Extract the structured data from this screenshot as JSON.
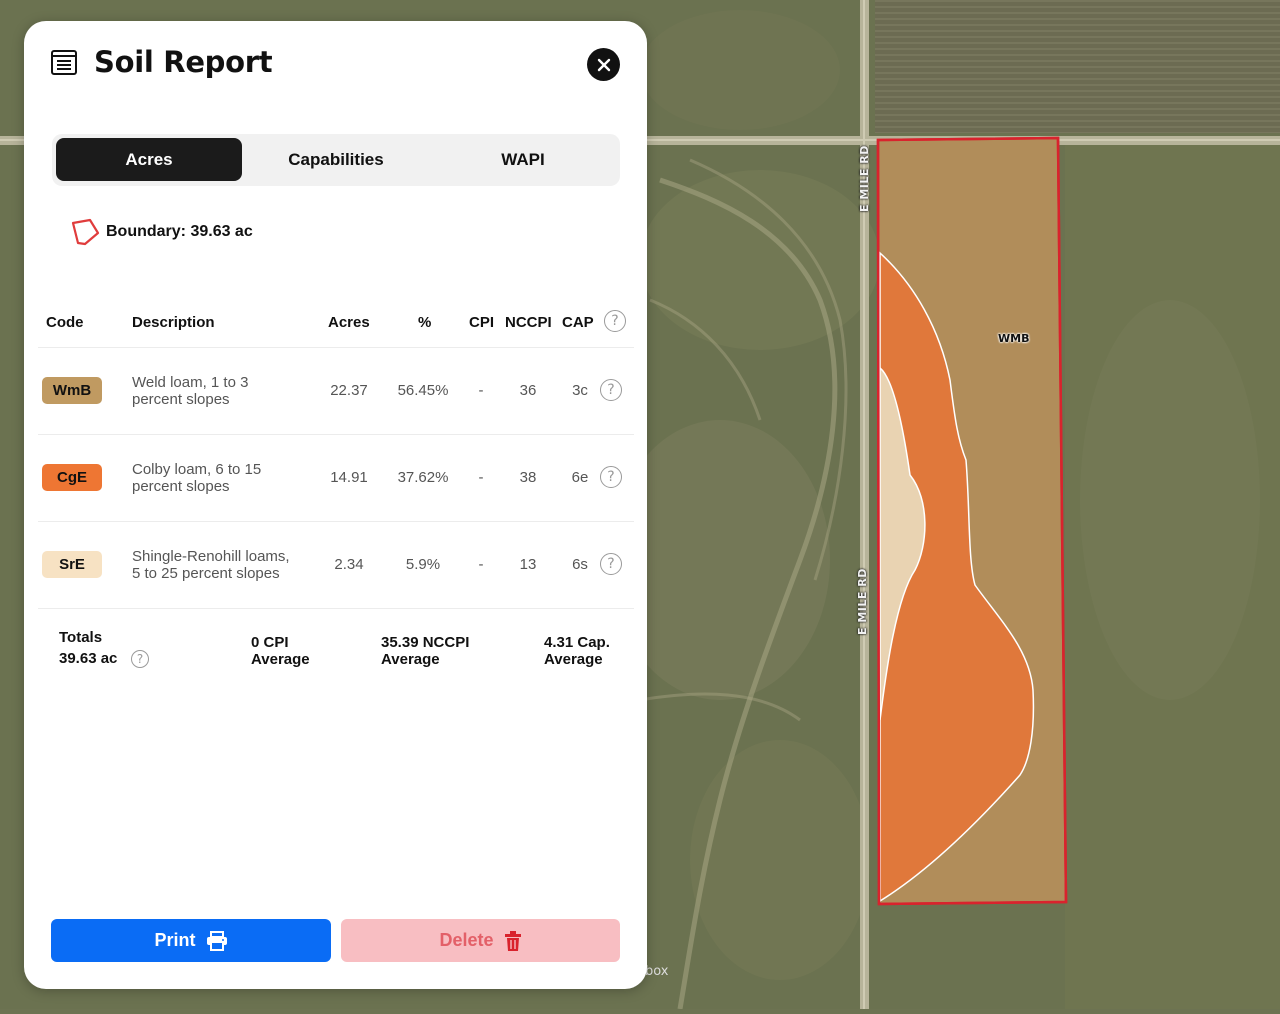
{
  "panel": {
    "title": "Soil Report",
    "tabs": [
      {
        "label": "Acres",
        "active": true
      },
      {
        "label": "Capabilities",
        "active": false
      },
      {
        "label": "WAPI",
        "active": false
      }
    ],
    "boundary_text": "Boundary: 39.63 ac",
    "table": {
      "headers": {
        "code": "Code",
        "description": "Description",
        "acres": "Acres",
        "percent": "%",
        "cpi": "CPI",
        "nccpi": "NCCPI",
        "cap": "CAP"
      },
      "rows": [
        {
          "code": "WmB",
          "color": "#c09a61",
          "description": "Weld loam, 1 to 3 percent slopes",
          "acres": "22.37",
          "percent": "56.45%",
          "cpi": "-",
          "nccpi": "36",
          "cap": "3c"
        },
        {
          "code": "CgE",
          "color": "#ee7633",
          "description": "Colby loam, 6 to 15 percent slopes",
          "acres": "14.91",
          "percent": "37.62%",
          "cpi": "-",
          "nccpi": "38",
          "cap": "6e"
        },
        {
          "code": "SrE",
          "color": "#f7e2c3",
          "description": "Shingle-Renohill loams, 5 to 25 percent slopes",
          "acres": "2.34",
          "percent": "5.9%",
          "cpi": "-",
          "nccpi": "13",
          "cap": "6s"
        }
      ]
    },
    "totals": {
      "label": "Totals",
      "acres": "39.63 ac",
      "cpi_value": "0 CPI",
      "cpi_sub": "Average",
      "nccpi_value": "35.39 NCCPI",
      "nccpi_sub": "Average",
      "cap_value": "4.31 Cap.",
      "cap_sub": "Average"
    },
    "buttons": {
      "print": "Print",
      "delete": "Delete"
    }
  },
  "map": {
    "road_label_top": "E MILE RD",
    "road_label_bottom": "E MILE RD",
    "field_soil_label": "WMB",
    "attribution": "box"
  },
  "icons": {
    "report": "document-list-icon",
    "close": "close-icon",
    "boundary": "polygon-icon",
    "help": "question-circle-icon",
    "print": "printer-icon",
    "delete": "trash-icon"
  },
  "colors": {
    "print_button": "#0a6cf5",
    "delete_button": "#f8bec2",
    "active_tab": "#1b1b1b",
    "field_boundary": "#d9232d"
  }
}
